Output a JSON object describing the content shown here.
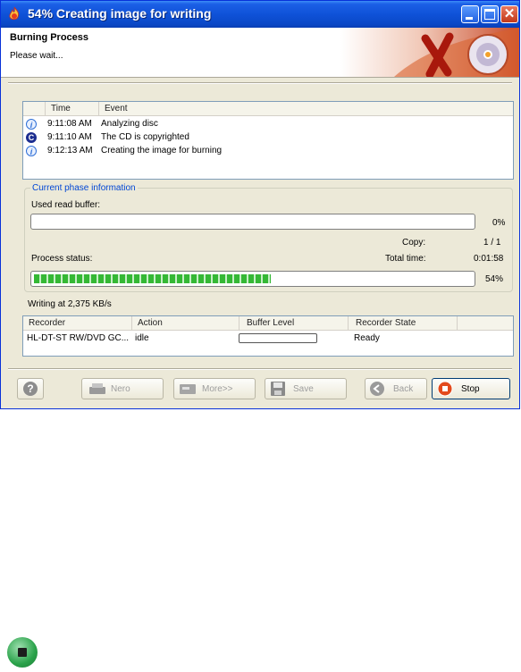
{
  "window": {
    "title": "54% Creating image for writing"
  },
  "banner": {
    "title": "Burning Process",
    "subtitle": "Please wait..."
  },
  "events": {
    "headers": [
      "Time",
      "Event"
    ],
    "rows": [
      {
        "icon": "info-icon",
        "time": "9:11:08 AM",
        "text": "Analyzing disc"
      },
      {
        "icon": "copyright-icon",
        "time": "9:11:10 AM",
        "text": "The CD is copyrighted"
      },
      {
        "icon": "info-icon",
        "time": "9:12:13 AM",
        "text": "Creating the image for burning"
      }
    ]
  },
  "phase": {
    "legend": "Current phase information",
    "read_buffer_label": "Used read buffer:",
    "read_buffer_value": 0,
    "read_buffer_text": "0%",
    "copy_label": "Copy:",
    "copy_value": "1 / 1",
    "status_label": "Process status:",
    "total_time_label": "Total time:",
    "total_time_value": "0:01:58",
    "progress_value": 54,
    "progress_text": "54%"
  },
  "writing_speed": "Writing at 2,375 KB/s",
  "recorders": {
    "headers": [
      "Recorder",
      "Action",
      "Buffer Level",
      "Recorder State"
    ],
    "rows": [
      {
        "recorder": "HL-DT-ST RW/DVD GC...",
        "action": "idle",
        "buffer_level": 0,
        "state": "Ready"
      }
    ]
  },
  "buttons": {
    "help": "",
    "nero": "Nero",
    "more": "More>>",
    "save": "Save",
    "back": "Back",
    "stop": "Stop"
  },
  "colors": {
    "title_bar": "#0a47c6",
    "progress": "#35b835",
    "legend": "#0046d5"
  }
}
